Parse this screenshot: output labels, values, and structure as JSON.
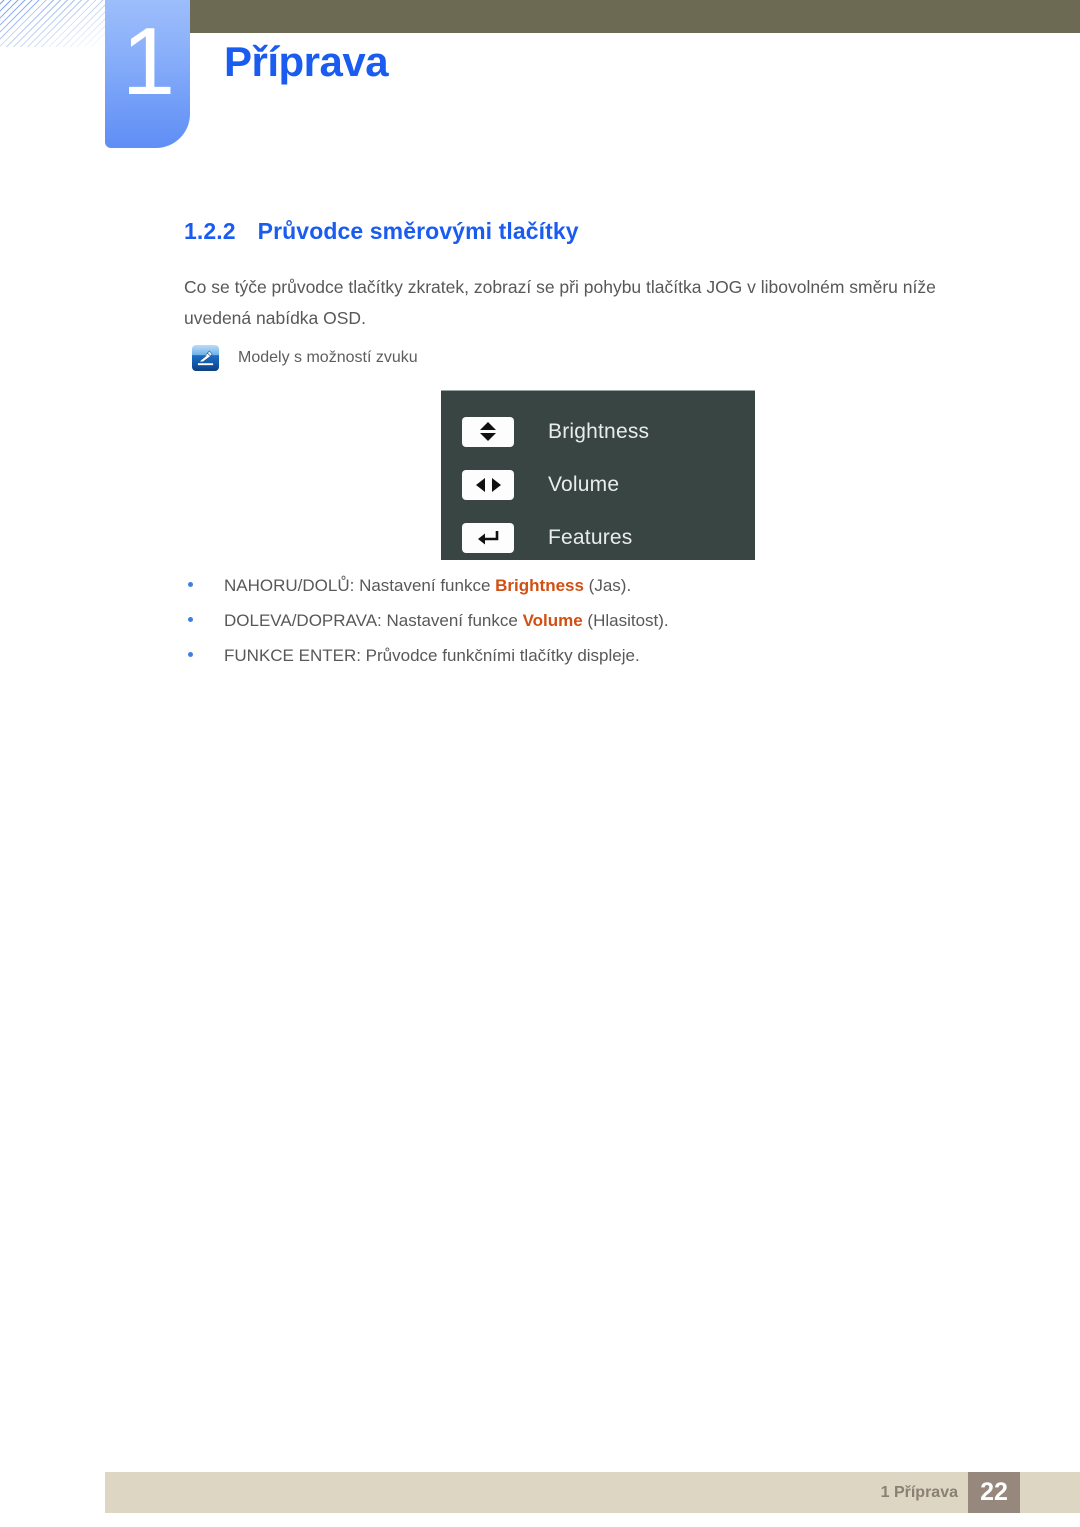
{
  "header": {
    "chapter_number": "1",
    "chapter_title": "Příprava",
    "accent_blue": "#1a5cf0",
    "olive_bar_color": "#6d6a53"
  },
  "section": {
    "number": "1.2.2",
    "title": "Průvodce směrovými tlačítky",
    "intro": "Co se týče průvodce tlačítky zkratek, zobrazí se při pohybu tlačítka JOG v libovolném směru níže uvedená nabídka OSD."
  },
  "note": {
    "icon": "note-pen-icon",
    "text": "Modely s možností zvuku"
  },
  "osd": {
    "background": "#394543",
    "rows": [
      {
        "key_icon": "up-down-arrows-icon",
        "label": "Brightness"
      },
      {
        "key_icon": "left-right-arrows-icon",
        "label": "Volume"
      },
      {
        "key_icon": "enter-arrow-icon",
        "label": "Features"
      }
    ]
  },
  "bullets": [
    {
      "prefix": "NAHORU/DOLŮ: Nastavení funkce ",
      "highlight": "Brightness",
      "suffix": " (Jas)."
    },
    {
      "prefix": "DOLEVA/DOPRAVA: Nastavení funkce ",
      "highlight": "Volume",
      "suffix": " (Hlasitost)."
    },
    {
      "prefix": "FUNKCE ENTER: Průvodce funkčními tlačítky displeje.",
      "highlight": "",
      "suffix": ""
    }
  ],
  "footer": {
    "label": "1 Příprava",
    "page_number": "22",
    "bar_color": "#dcd6c3",
    "page_box_color": "#96887c"
  }
}
